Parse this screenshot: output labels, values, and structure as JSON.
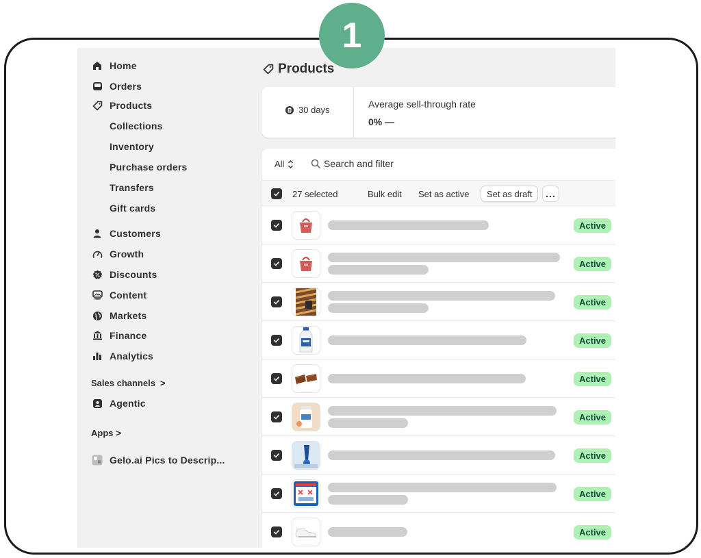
{
  "step_badge": "1",
  "sidebar": {
    "nav": [
      {
        "label": "Home",
        "icon": "home-icon"
      },
      {
        "label": "Orders",
        "icon": "inbox-icon"
      },
      {
        "label": "Products",
        "icon": "tag-icon"
      }
    ],
    "product_subitems": [
      "Collections",
      "Inventory",
      "Purchase orders",
      "Transfers",
      "Gift cards"
    ],
    "nav2": [
      {
        "label": "Customers",
        "icon": "person-icon"
      },
      {
        "label": "Growth",
        "icon": "gauge-icon"
      },
      {
        "label": "Discounts",
        "icon": "discount-icon"
      },
      {
        "label": "Content",
        "icon": "content-icon"
      },
      {
        "label": "Markets",
        "icon": "globe-icon"
      },
      {
        "label": "Finance",
        "icon": "bank-icon"
      },
      {
        "label": "Analytics",
        "icon": "bar-chart-icon"
      }
    ],
    "sales_channels_label": "Sales channels",
    "sales_channels_chevron": ">",
    "agentic_label": "Agentic",
    "apps_label": "Apps",
    "apps_chevron": ">",
    "app_item_label": "Gelo.ai Pics to Descrip..."
  },
  "page": {
    "title": "Products"
  },
  "stats": {
    "period": "30 days",
    "metric_label": "Average sell-through rate",
    "metric_value": "0% —"
  },
  "filter": {
    "view_label": "All",
    "search_label": "Search and filter"
  },
  "bulk": {
    "selected_count": "27 selected",
    "bulk_edit": "Bulk edit",
    "set_active": "Set as active",
    "set_draft": "Set as draft",
    "more": "..."
  },
  "products": [
    {
      "status": "Active",
      "thumb": "red-bag",
      "thumb_icon": "red-bag-product-image"
    },
    {
      "status": "Active",
      "thumb": "red-bag",
      "thumb_icon": "red-bag-product-image"
    },
    {
      "status": "Active",
      "thumb": "striped",
      "thumb_icon": "striped-fabric-product-image"
    },
    {
      "status": "Active",
      "thumb": "bottle",
      "thumb_icon": "milk-bottle-product-image"
    },
    {
      "status": "Active",
      "thumb": "chocolate",
      "thumb_icon": "chocolate-bar-product-image"
    },
    {
      "status": "Active",
      "thumb": "jar",
      "thumb_icon": "supplement-jar-product-image"
    },
    {
      "status": "Active",
      "thumb": "device",
      "thumb_icon": "blue-device-product-image"
    },
    {
      "status": "Active",
      "thumb": "box",
      "thumb_icon": "blue-box-product-image"
    },
    {
      "status": "Active",
      "thumb": "shoe",
      "thumb_icon": "white-shoe-product-image"
    }
  ],
  "colors": {
    "badge": "#5fae8c",
    "status_bg": "#aff0b5",
    "status_text": "#0c5132",
    "placeholder_bar": "#cfcfcf"
  }
}
